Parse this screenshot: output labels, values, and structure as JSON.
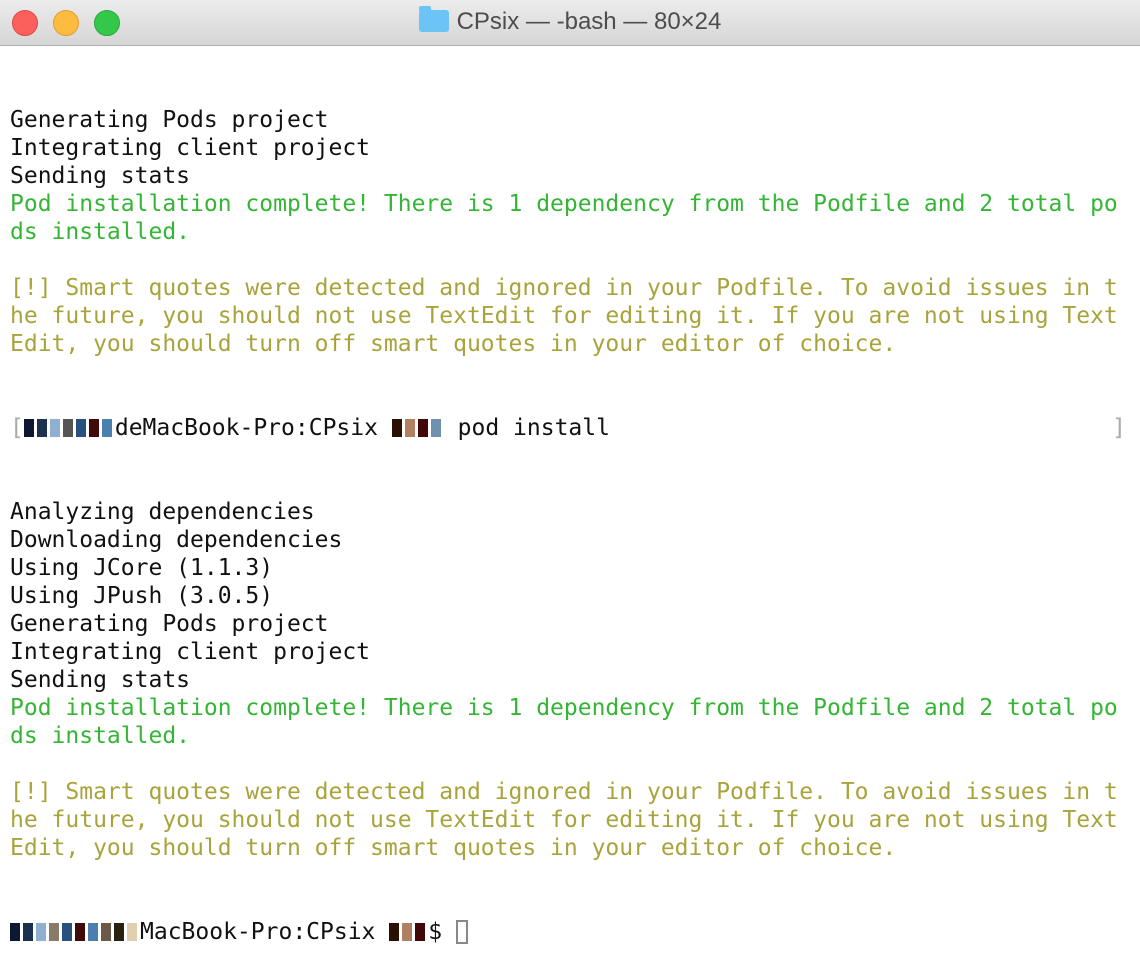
{
  "window": {
    "title": "CPsix — -bash — 80×24",
    "folder_icon": "folder-icon"
  },
  "colors": {
    "success": "#35b535",
    "warning": "#a9a33b",
    "text": "#111111"
  },
  "lines": [
    {
      "text": "Generating Pods project",
      "color": "default"
    },
    {
      "text": "Integrating client project",
      "color": "default"
    },
    {
      "text": "Sending stats",
      "color": "default"
    },
    {
      "text": "Pod installation complete! There is 1 dependency from the Podfile and 2 total po",
      "color": "green"
    },
    {
      "text": "ds installed.",
      "color": "green"
    },
    {
      "text": "",
      "color": "default"
    },
    {
      "text": "[!] Smart quotes were detected and ignored in your Podfile. To avoid issues in t",
      "color": "olive"
    },
    {
      "text": "he future, you should not use TextEdit for editing it. If you are not using Text",
      "color": "olive"
    },
    {
      "text": "Edit, you should turn off smart quotes in your editor of choice.",
      "color": "olive"
    }
  ],
  "prompt1": {
    "host": "deMacBook-Pro:CPsix ",
    "command": " pod install"
  },
  "lines2": [
    {
      "text": "Analyzing dependencies",
      "color": "default"
    },
    {
      "text": "Downloading dependencies",
      "color": "default"
    },
    {
      "text": "Using JCore (1.1.3)",
      "color": "default"
    },
    {
      "text": "Using JPush (3.0.5)",
      "color": "default"
    },
    {
      "text": "Generating Pods project",
      "color": "default"
    },
    {
      "text": "Integrating client project",
      "color": "default"
    },
    {
      "text": "Sending stats",
      "color": "default"
    },
    {
      "text": "Pod installation complete! There is 1 dependency from the Podfile and 2 total po",
      "color": "green"
    },
    {
      "text": "ds installed.",
      "color": "green"
    },
    {
      "text": "",
      "color": "default"
    },
    {
      "text": "[!] Smart quotes were detected and ignored in your Podfile. To avoid issues in t",
      "color": "olive"
    },
    {
      "text": "he future, you should not use TextEdit for editing it. If you are not using Text",
      "color": "olive"
    },
    {
      "text": "Edit, you should turn off smart quotes in your editor of choice.",
      "color": "olive"
    }
  ],
  "prompt2": {
    "host": "MacBook-Pro:CPsix ",
    "symbol": "$ "
  }
}
